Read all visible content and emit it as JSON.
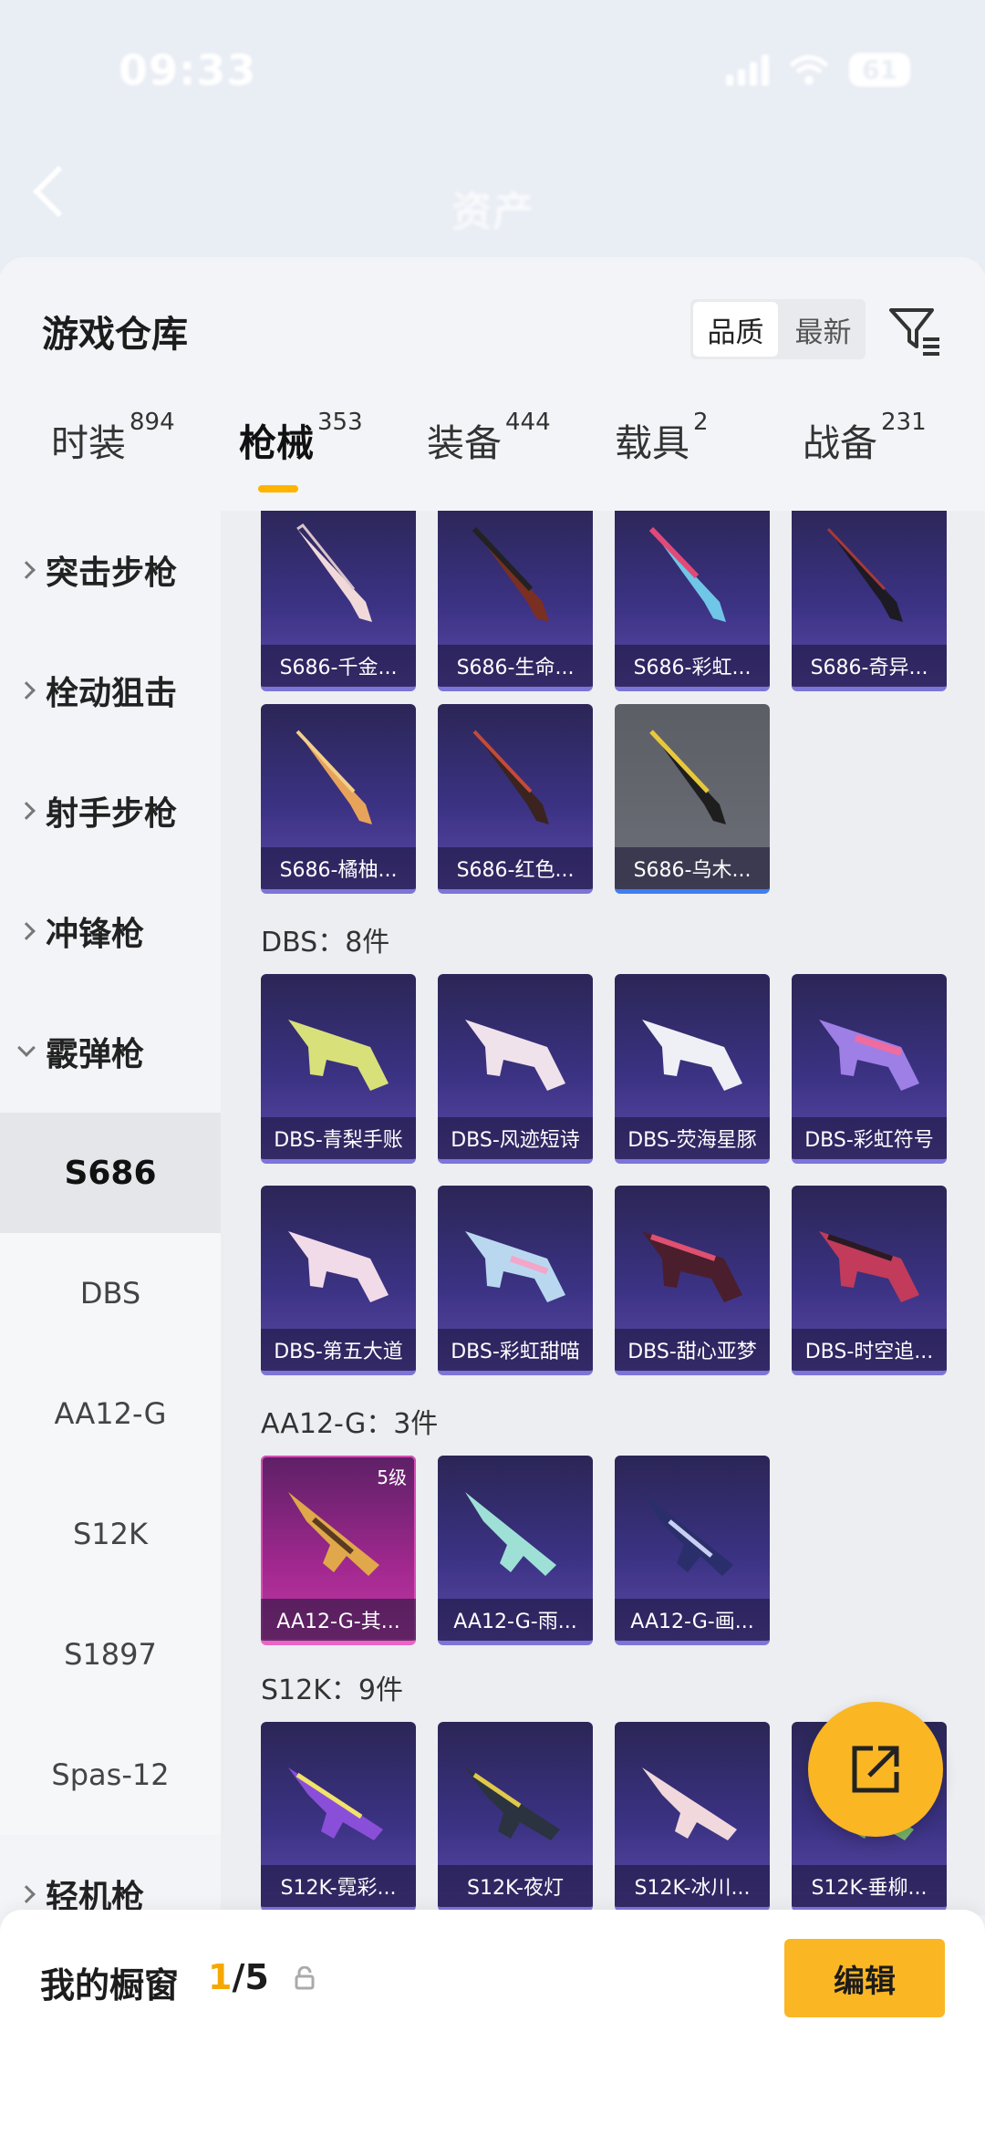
{
  "status_bar": {
    "time": "09:33",
    "battery": "61"
  },
  "background_nav": {
    "title": "资产"
  },
  "sheet": {
    "title": "游戏仓库",
    "sort_options": [
      "品质",
      "最新"
    ],
    "tabs": [
      {
        "label": "时装",
        "count": "894"
      },
      {
        "label": "枪械",
        "count": "353"
      },
      {
        "label": "装备",
        "count": "444"
      },
      {
        "label": "载具",
        "count": "2"
      },
      {
        "label": "战备",
        "count": "231"
      }
    ]
  },
  "sidebar": {
    "categories": [
      {
        "label": "突击步枪"
      },
      {
        "label": "栓动狙击"
      },
      {
        "label": "射手步枪"
      },
      {
        "label": "冲锋枪"
      },
      {
        "label": "霰弹枪"
      }
    ],
    "subcategories": [
      "S686",
      "DBS",
      "AA12-G",
      "S12K",
      "S1897",
      "Spas-12"
    ],
    "last_category": "轻机枪"
  },
  "groups": {
    "s686": {
      "items": [
        "S686-千金...",
        "S686-生命...",
        "S686-彩虹...",
        "S686-奇异...",
        "S686-橘柚...",
        "S686-红色...",
        "S686-乌木..."
      ]
    },
    "dbs": {
      "label": "DBS：8件",
      "items": [
        "DBS-青梨手账",
        "DBS-风迹短诗",
        "DBS-荧海星豚",
        "DBS-彩虹符号",
        "DBS-第五大道",
        "DBS-彩虹甜喵",
        "DBS-甜心亚梦",
        "DBS-时空追..."
      ]
    },
    "aa12g": {
      "label": "AA12-G：3件",
      "tier_badge": "5级",
      "items": [
        "AA12-G-其...",
        "AA12-G-雨...",
        "AA12-G-画..."
      ]
    },
    "s12k": {
      "label": "S12K：9件",
      "items": [
        "S12K-霓彩...",
        "S12K-夜灯",
        "S12K-冰川...",
        "S12K-垂柳..."
      ]
    }
  },
  "bottom_bar": {
    "title": "我的橱窗",
    "count_current": "1",
    "count_total": "/5",
    "edit_label": "编辑"
  },
  "colors": {
    "accent": "#fbb623",
    "tab_underline": "#ffb400"
  }
}
